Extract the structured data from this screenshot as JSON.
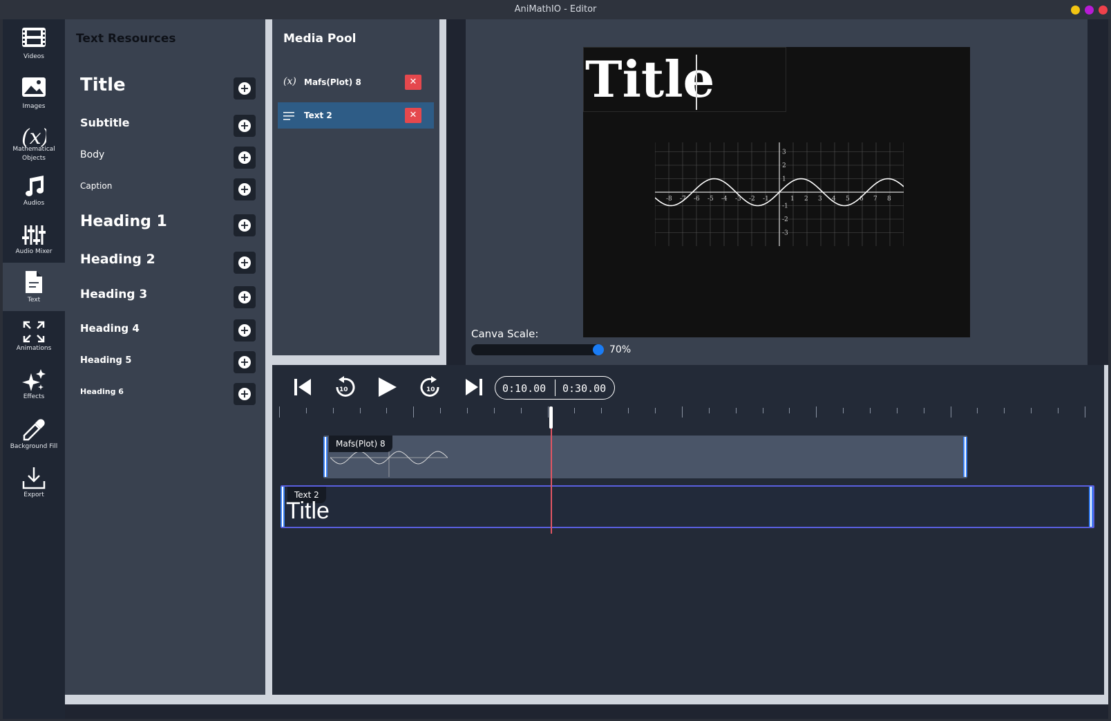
{
  "window": {
    "title": "AniMathIO - Editor",
    "buttons": [
      {
        "name": "minimize",
        "color": "#f2c412"
      },
      {
        "name": "maximize",
        "color": "#b81bd6"
      },
      {
        "name": "close",
        "color": "#f0414b"
      }
    ]
  },
  "toolbar": {
    "items": [
      {
        "id": "videos",
        "label": "Videos",
        "icon": "film-icon"
      },
      {
        "id": "images",
        "label": "Images",
        "icon": "image-icon"
      },
      {
        "id": "math",
        "label": "Mathematical Objects",
        "icon": "function-x-icon"
      },
      {
        "id": "audios",
        "label": "Audios",
        "icon": "music-note-icon"
      },
      {
        "id": "mixer",
        "label": "Audio Mixer",
        "icon": "sliders-icon"
      },
      {
        "id": "text",
        "label": "Text",
        "icon": "document-text-icon",
        "active": true
      },
      {
        "id": "animations",
        "label": "Animations",
        "icon": "expand-arrows-icon"
      },
      {
        "id": "effects",
        "label": "Effects",
        "icon": "sparkles-icon"
      },
      {
        "id": "background",
        "label": "Background Fill",
        "icon": "eyedropper-icon"
      },
      {
        "id": "export",
        "label": "Export",
        "icon": "download-icon"
      }
    ]
  },
  "text_resources": {
    "heading": "Text Resources",
    "items": [
      {
        "label": "Title"
      },
      {
        "label": "Subtitle"
      },
      {
        "label": "Body"
      },
      {
        "label": "Caption"
      },
      {
        "label": "Heading 1"
      },
      {
        "label": "Heading 2"
      },
      {
        "label": "Heading 3"
      },
      {
        "label": "Heading 4"
      },
      {
        "label": "Heading 5"
      },
      {
        "label": "Heading 6"
      }
    ]
  },
  "media_pool": {
    "heading": "Media Pool",
    "items": [
      {
        "label": "Mafs(Plot) 8",
        "icon": "function-x-icon",
        "selected": false
      },
      {
        "label": "Text 2",
        "icon": "text-lines-icon",
        "selected": true
      }
    ]
  },
  "canvas": {
    "title_text": "Title",
    "plot": {
      "function": "sine",
      "x_ticks": [
        "-8",
        "-7",
        "-6",
        "-5",
        "-4",
        "-3",
        "-2",
        "-1",
        "1",
        "2",
        "3",
        "4",
        "5",
        "6",
        "7",
        "8"
      ],
      "y_ticks": [
        "3",
        "2",
        "1",
        "-1",
        "-2",
        "-3"
      ]
    },
    "scale_label": "Canva Scale:",
    "scale_value": "70%",
    "scale_fraction": 0.7
  },
  "timeline": {
    "current_time": "0:10.00",
    "total_time": "0:30.00",
    "controls": [
      "skip-back-icon",
      "rewind-10-icon",
      "play-icon",
      "forward-10-icon",
      "skip-forward-icon"
    ],
    "tracks": [
      {
        "label": "Mafs(Plot) 8",
        "type": "plot"
      },
      {
        "label": "Text 2",
        "type": "text",
        "preview_text": "Title",
        "selected": true
      }
    ]
  }
}
